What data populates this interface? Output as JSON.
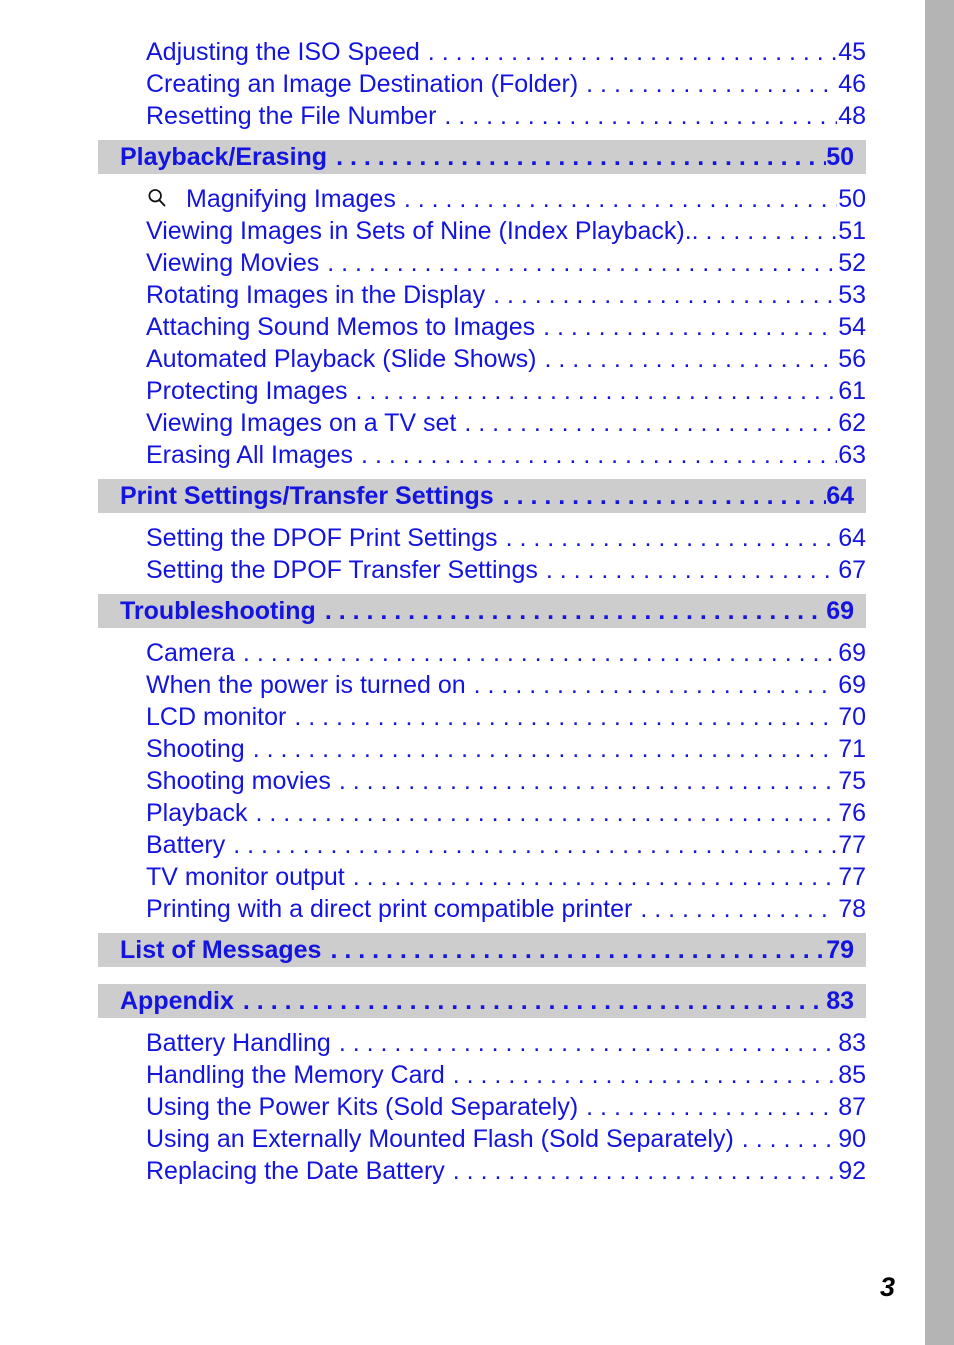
{
  "page": {
    "number": "3",
    "accent_blue": "#1414E1",
    "bar_gray": "#CDCDCD",
    "edge_gray": "#B4B4B4"
  },
  "toc": {
    "leading_entries": [
      {
        "title": "Adjusting the ISO Speed",
        "page": "45",
        "icon": null
      },
      {
        "title": "Creating an Image Destination (Folder)",
        "page": "46",
        "icon": null
      },
      {
        "title": "Resetting the File Number",
        "page": "48",
        "icon": null
      }
    ],
    "sections": [
      {
        "heading": "Playback/Erasing",
        "heading_page": "50",
        "entries": [
          {
            "title": "Magnifying Images",
            "page": "50",
            "icon": "magnifier-icon"
          },
          {
            "title": "Viewing Images in Sets of Nine (Index Playback).",
            "page": "51",
            "icon": null
          },
          {
            "title": "Viewing Movies",
            "page": "52",
            "icon": null
          },
          {
            "title": "Rotating Images in the Display",
            "page": "53",
            "icon": null
          },
          {
            "title": "Attaching Sound Memos to Images",
            "page": "54",
            "icon": null
          },
          {
            "title": "Automated Playback (Slide Shows)",
            "page": "56",
            "icon": null
          },
          {
            "title": "Protecting Images",
            "page": "61",
            "icon": null
          },
          {
            "title": "Viewing Images on a TV set",
            "page": "62",
            "icon": null
          },
          {
            "title": "Erasing All Images",
            "page": "63",
            "icon": null
          }
        ]
      },
      {
        "heading": "Print Settings/Transfer Settings",
        "heading_page": "64",
        "entries": [
          {
            "title": "Setting the DPOF Print Settings",
            "page": "64",
            "icon": null
          },
          {
            "title": "Setting the DPOF Transfer Settings",
            "page": "67",
            "icon": null
          }
        ]
      },
      {
        "heading": "Troubleshooting",
        "heading_page": "69",
        "entries": [
          {
            "title": "Camera",
            "page": "69",
            "icon": null
          },
          {
            "title": "When the power is turned on",
            "page": "69",
            "icon": null
          },
          {
            "title": "LCD monitor",
            "page": "70",
            "icon": null
          },
          {
            "title": "Shooting",
            "page": "71",
            "icon": null
          },
          {
            "title": "Shooting movies",
            "page": "75",
            "icon": null
          },
          {
            "title": "Playback",
            "page": "76",
            "icon": null
          },
          {
            "title": "Battery",
            "page": "77",
            "icon": null
          },
          {
            "title": "TV monitor output",
            "page": "77",
            "icon": null
          },
          {
            "title": "Printing with a direct print compatible printer",
            "page": "78",
            "icon": null
          }
        ]
      },
      {
        "heading": "List of Messages",
        "heading_page": "79",
        "entries": []
      },
      {
        "heading": "Appendix",
        "heading_page": "83",
        "entries": [
          {
            "title": "Battery Handling",
            "page": "83",
            "icon": null
          },
          {
            "title": "Handling the Memory Card",
            "page": "85",
            "icon": null
          },
          {
            "title": "Using the Power Kits (Sold Separately)",
            "page": "87",
            "icon": null
          },
          {
            "title": "Using an Externally Mounted Flash (Sold Separately)",
            "page": "90",
            "icon": null
          },
          {
            "title": "Replacing the Date Battery",
            "page": "92",
            "icon": null
          }
        ]
      }
    ]
  }
}
